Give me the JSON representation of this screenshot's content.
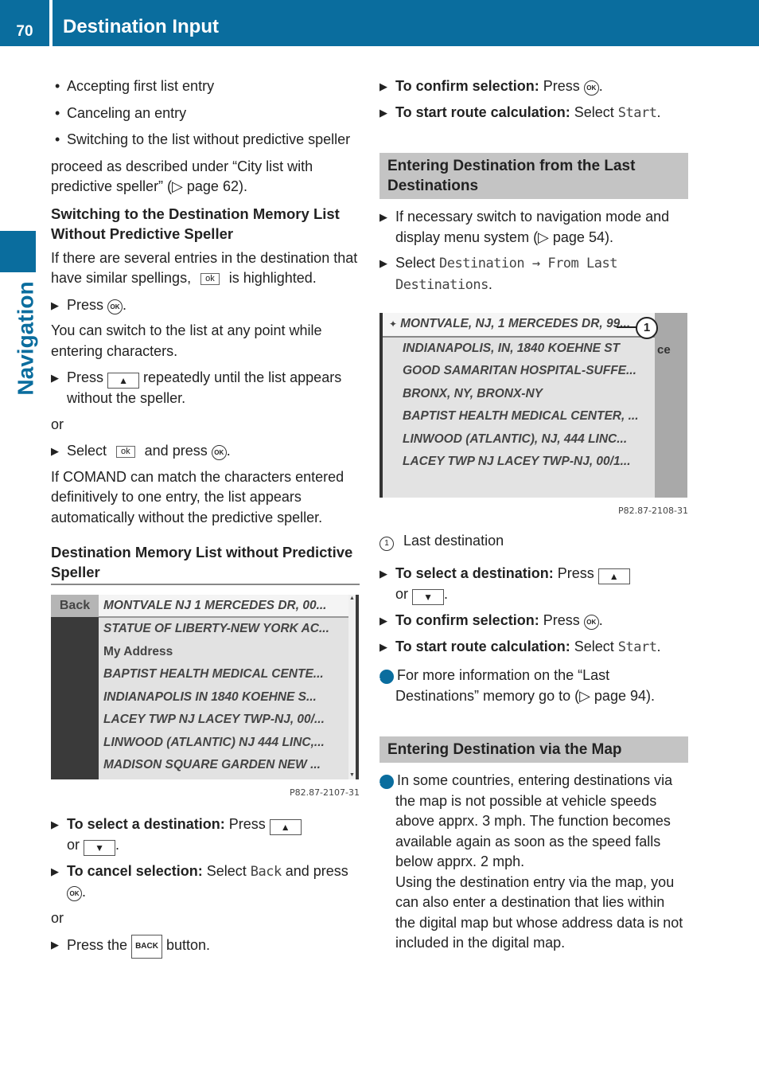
{
  "header": {
    "page_number": "70",
    "title": "Destination Input"
  },
  "side_tab": {
    "label": "Navigation"
  },
  "left": {
    "bullets": [
      "Accepting first list entry",
      "Canceling an entry",
      "Switching to the list without predictive speller"
    ],
    "proceed": "proceed as described under “City list with predictive speller” (▷ page 62).",
    "h_switching": "Switching to the Destination Memory List Without Predictive Speller",
    "p_several_a": "If there are several entries in the destination that have similar spellings,",
    "ok_key": "ok",
    "p_several_b": "is highlighted.",
    "step_press": "Press",
    "ok_circle": "OK",
    "p_switch_any": "You can switch to the list at any point while entering characters.",
    "step_press_up_a": "Press",
    "up_key": "▲",
    "down_key": "▼",
    "step_press_up_b": "repeatedly until the list appears without the speller.",
    "or": "or",
    "step_select_a": "Select",
    "step_select_b": "and press",
    "p_comand": "If COMAND can match the characters entered definitively to one entry, the list appears automatically without the predictive speller.",
    "h_memory": "Destination Memory List without Predictive Speller",
    "screen": {
      "back": "Back",
      "rows": [
        "MONTVALE NJ 1 MERCEDES DR, 00...",
        "STATUE OF LIBERTY-NEW YORK AC...",
        "My Address",
        "BAPTIST HEALTH MEDICAL CENTE...",
        "INDIANAPOLIS IN 1840 KOEHNE S...",
        "LACEY TWP NJ LACEY TWP-NJ, 00/...",
        "LINWOOD (ATLANTIC) NJ 444 LINC,...",
        "MADISON SQUARE GARDEN NEW ..."
      ],
      "caption": "P82.87-2107-31"
    },
    "sel_label": "To select a destination:",
    "sel_text": "Press",
    "cancel_label": "To cancel selection:",
    "cancel_text_a": "Select",
    "cancel_mono": "Back",
    "cancel_text_b": "and press",
    "press_the": "Press the",
    "back_key": "BACK",
    "button_word": "button."
  },
  "right": {
    "confirm_label": "To confirm selection:",
    "confirm_text": "Press",
    "route_label": "To start route calculation:",
    "route_text": "Select",
    "start_mono": "Start",
    "h_last": "Entering Destination from the Last Destinations",
    "step_nav": "If necessary switch to navigation mode and display menu system (▷ page 54).",
    "step_select": "Select",
    "menu_path": "Destination → From Last Destinations",
    "screen": {
      "rows": [
        "MONTVALE, NJ, 1 MERCEDES DR, 99...",
        "INDIANAPOLIS, IN, 1840 KOEHNE ST",
        "GOOD SAMARITAN HOSPITAL-SUFFE...",
        "BRONX, NY, BRONX-NY",
        "BAPTIST HEALTH MEDICAL CENTER, ...",
        "LINWOOD (ATLANTIC), NJ, 444 LINC...",
        "LACEY TWP NJ LACEY TWP-NJ, 00/1..."
      ],
      "side_text": "ce",
      "callout": "1",
      "caption": "P82.87-2108-31"
    },
    "legend_num": "1",
    "legend_text": "Last destination",
    "info_last": "For more information on the “Last Destinations” memory go to (▷ page 94).",
    "h_map": "Entering Destination via the Map",
    "info_map_1": "In some countries, entering destinations via the map is not possible at vehicle speeds above apprx. 3 mph. The function becomes available again as soon as the speed falls below apprx. 2 mph.",
    "info_map_2": "Using the destination entry via the map, you can also enter a destination that lies within the digital map but whose address data is not included in the digital map."
  }
}
